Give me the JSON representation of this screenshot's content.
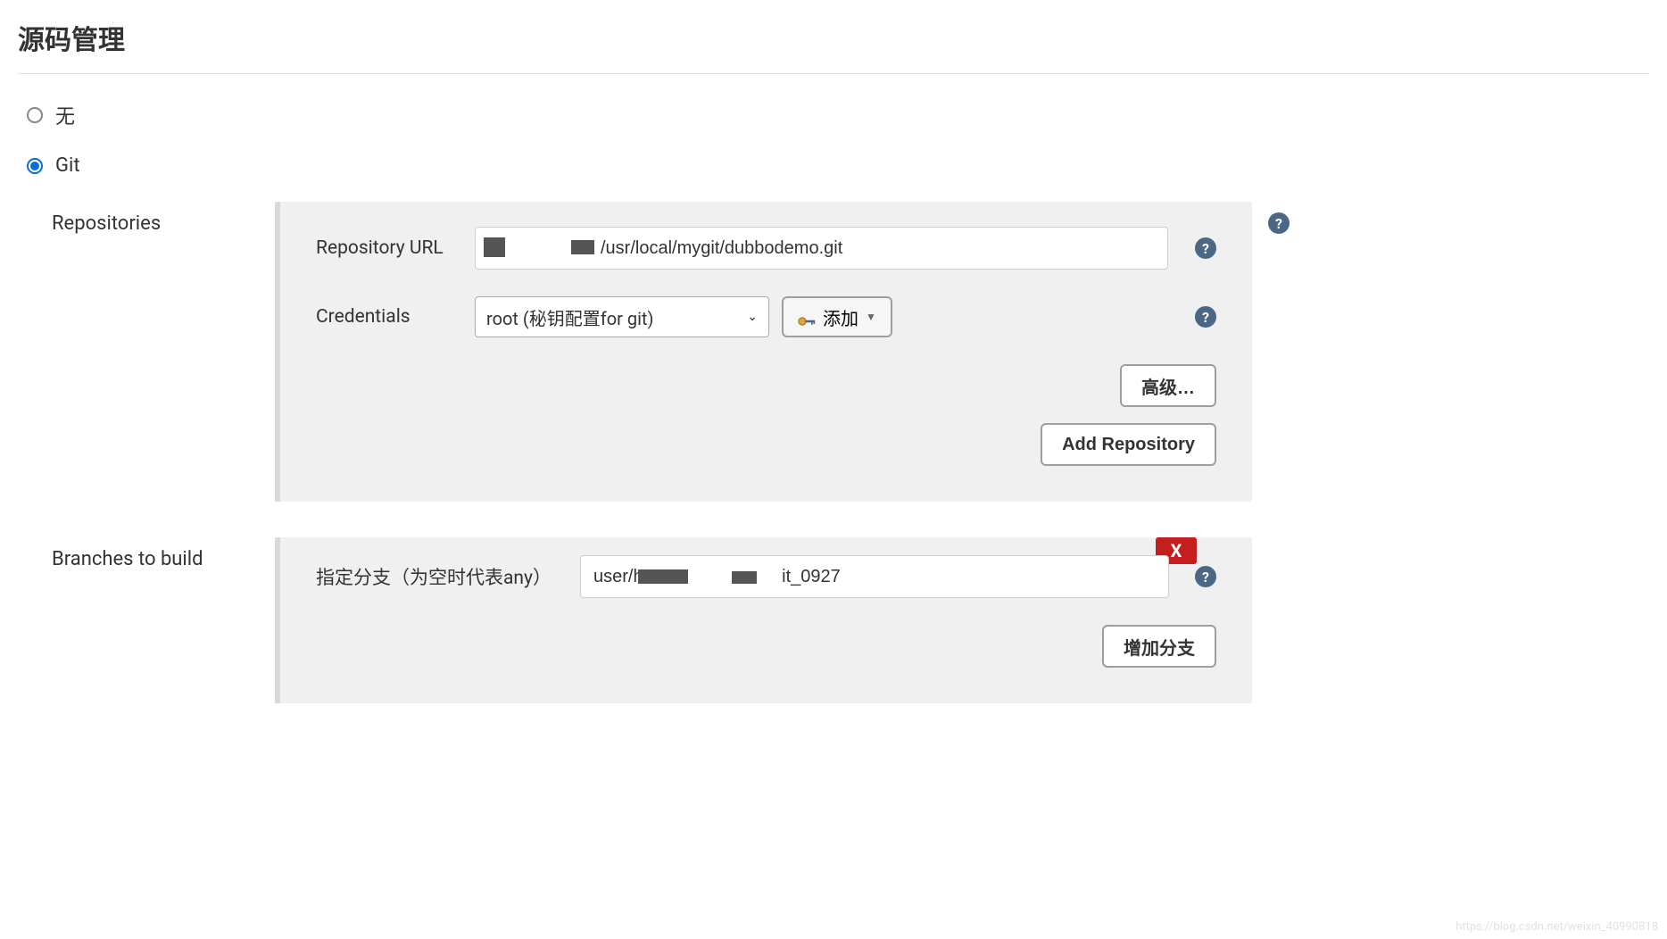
{
  "section": {
    "title": "源码管理"
  },
  "scm_options": {
    "none_label": "无",
    "git_label": "Git"
  },
  "repositories": {
    "section_label": "Repositories",
    "url_label": "Repository URL",
    "url_value": "/usr/local/mygit/dubbodemo.git",
    "credentials_label": "Credentials",
    "credentials_selected": "root (秘钥配置for git)",
    "add_button_label": "添加",
    "advanced_button_label": "高级…",
    "add_repo_button_label": "Add Repository"
  },
  "branches": {
    "section_label": "Branches to build",
    "branch_spec_label": "指定分支（为空时代表any）",
    "branch_value_prefix": "user/",
    "branch_value_suffix": "it_0927",
    "delete_label": "X",
    "add_branch_label": "增加分支"
  },
  "help": {
    "tooltip": "?"
  },
  "watermark": "https://blog.csdn.net/weixin_40990818"
}
